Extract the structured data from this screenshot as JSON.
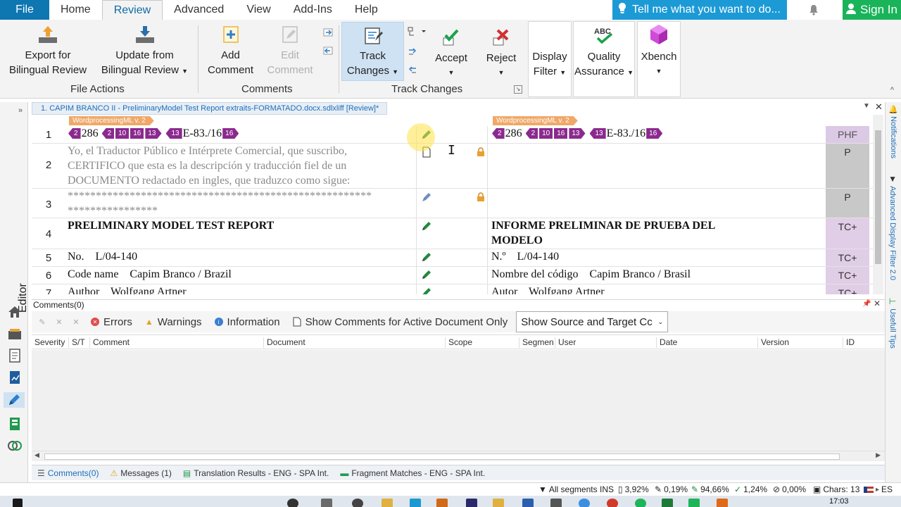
{
  "menu": {
    "file": "File",
    "tabs": [
      "Home",
      "Review",
      "Advanced",
      "View",
      "Add-Ins",
      "Help"
    ],
    "tell_me": "Tell me what you want to do...",
    "sign_in": "Sign In"
  },
  "ribbon": {
    "export_line1": "Export for",
    "export_line2": "Bilingual Review",
    "update_line1": "Update from",
    "update_line2": "Bilingual Review",
    "file_actions": "File Actions",
    "add_line1": "Add",
    "add_line2": "Comment",
    "edit_line1": "Edit",
    "edit_line2": "Comment",
    "comments": "Comments",
    "track_line1": "Track",
    "track_line2": "Changes",
    "accept": "Accept",
    "reject": "Reject",
    "track_changes_group": "Track Changes",
    "display_line1": "Display",
    "display_line2": "Filter",
    "qa_line1": "Quality",
    "qa_line2": "Assurance",
    "xbench": "Xbench"
  },
  "left_strip": {
    "editor_label": "Editor"
  },
  "right_strip": {
    "notifications": "Notifications",
    "adv_filter": "Advanced Display Filter 2.0",
    "usefull_tips": "Usefull Tips"
  },
  "doc_tab": "1. CAPIM BRANCO II - PreliminaryModel Test Report extraits-FORMATADO.docx.sdlxliff [Review]*",
  "editor": {
    "wml_source": "WordprocessingML v. 2",
    "wml_target": "WordprocessingML v. 2",
    "rows": [
      {
        "num": "1",
        "status": "PHF"
      },
      {
        "num": "2",
        "source_line1": "Yo, el Traductor Público e Intérprete Comercial, que suscribo,",
        "source_line2": "CERTIFICO que esta es la descripción y traducción fiel de un",
        "source_line3": "DOCUMENTO redactado en ingles, que traduzco como sigue:",
        "status": "P"
      },
      {
        "num": "3",
        "source_line1": "******************************************************",
        "source_line2": "****************",
        "status": "P"
      },
      {
        "num": "4",
        "source": "PRELIMINARY MODEL TEST REPORT",
        "target_line1": "INFORME PRELIMINAR DE PRUEBA DEL",
        "target_line2": "MODELO",
        "status": "TC+"
      },
      {
        "num": "5",
        "source": "No.    L/04-140",
        "target": "N.º    L/04-140",
        "status": "TC+"
      },
      {
        "num": "6",
        "source": "Code name    Capim Branco / Brazil",
        "target": "Nombre del código    Capim Branco / Brasil",
        "status": "TC+"
      },
      {
        "num": "7",
        "source": "Author    Wolfgang Artner",
        "target": "Autor    Wolfgang Artner",
        "status": "TC+"
      }
    ],
    "row1_tags": {
      "t2": "2",
      "text286": "286",
      "t2b": "2",
      "t10": "10",
      "t16": "16",
      "t13": "13",
      "t13b": "13",
      "code": "E-83./16",
      "t16b": "16"
    }
  },
  "comments_panel": {
    "title": "Comments(0)",
    "errors": "Errors",
    "warnings": "Warnings",
    "information": "Information",
    "active_only": "Show Comments for Active Document Only",
    "select_value": "Show Source and Target Cc",
    "columns": [
      "Severity",
      "S/T",
      "Comment",
      "Document",
      "Scope",
      "Segmen",
      "User",
      "Date",
      "Version",
      "ID"
    ]
  },
  "bottom_tabs": {
    "comments": "Comments(0)",
    "messages": "Messages (1)",
    "translation_results": "Translation Results - ENG - SPA Int.",
    "fragment_matches": "Fragment Matches - ENG - SPA Int."
  },
  "statusbar": {
    "filter": "All segments",
    "mode": "INS",
    "pct1": "3,92%",
    "pct2": "0,19%",
    "pct3": "94,66%",
    "pct4": "1,24%",
    "pct5": "0,00%",
    "chars": "Chars: 13",
    "lang": "ES"
  },
  "taskbar": {
    "time": "17:03"
  }
}
